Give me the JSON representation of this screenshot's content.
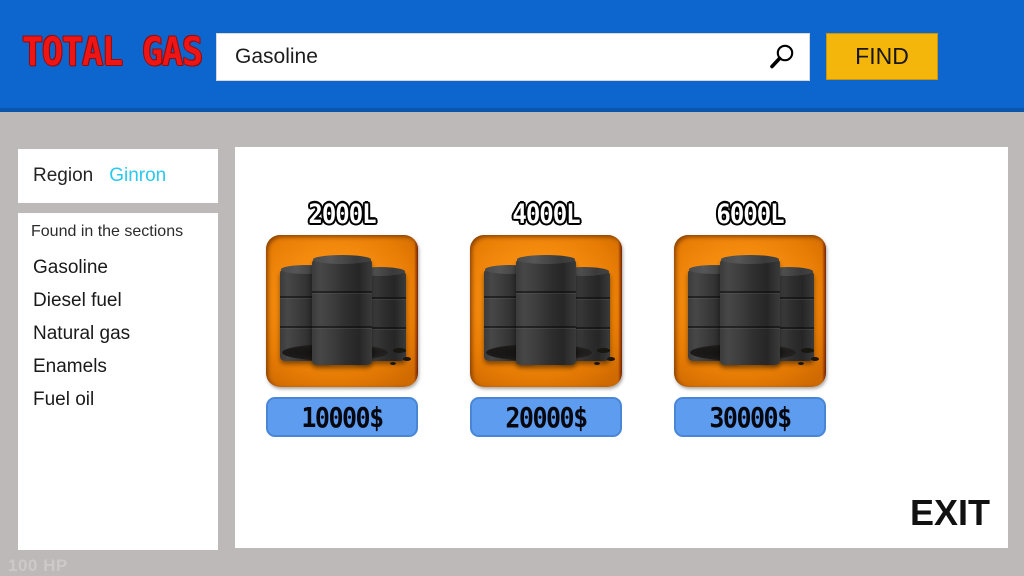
{
  "header": {
    "logo": "TOTAL GAS",
    "logo_color": "#f01515",
    "background_color": "#0c66cd",
    "search": {
      "value": "Gasoline",
      "placeholder": "Gasoline",
      "icon": "magnifier-icon"
    },
    "find_label": "FIND",
    "find_color": "#f5b60b"
  },
  "sidebar": {
    "region_label": "Region",
    "region_value": "Ginron",
    "region_value_color": "#2bc8ef",
    "sections_title": "Found in the sections",
    "sections": [
      {
        "label": "Gasoline"
      },
      {
        "label": "Diesel fuel"
      },
      {
        "label": "Natural gas"
      },
      {
        "label": "Enamels"
      },
      {
        "label": "Fuel oil"
      }
    ]
  },
  "main": {
    "products": [
      {
        "volume": "2000L",
        "price": "10000$",
        "icon": "oil-barrels-icon"
      },
      {
        "volume": "4000L",
        "price": "20000$",
        "icon": "oil-barrels-icon"
      },
      {
        "volume": "6000L",
        "price": "30000$",
        "icon": "oil-barrels-icon"
      }
    ],
    "exit_label": "EXIT",
    "tile_color": "#f78e10",
    "price_button_color": "#5d9cee"
  },
  "status": {
    "hp": "100 HP"
  }
}
